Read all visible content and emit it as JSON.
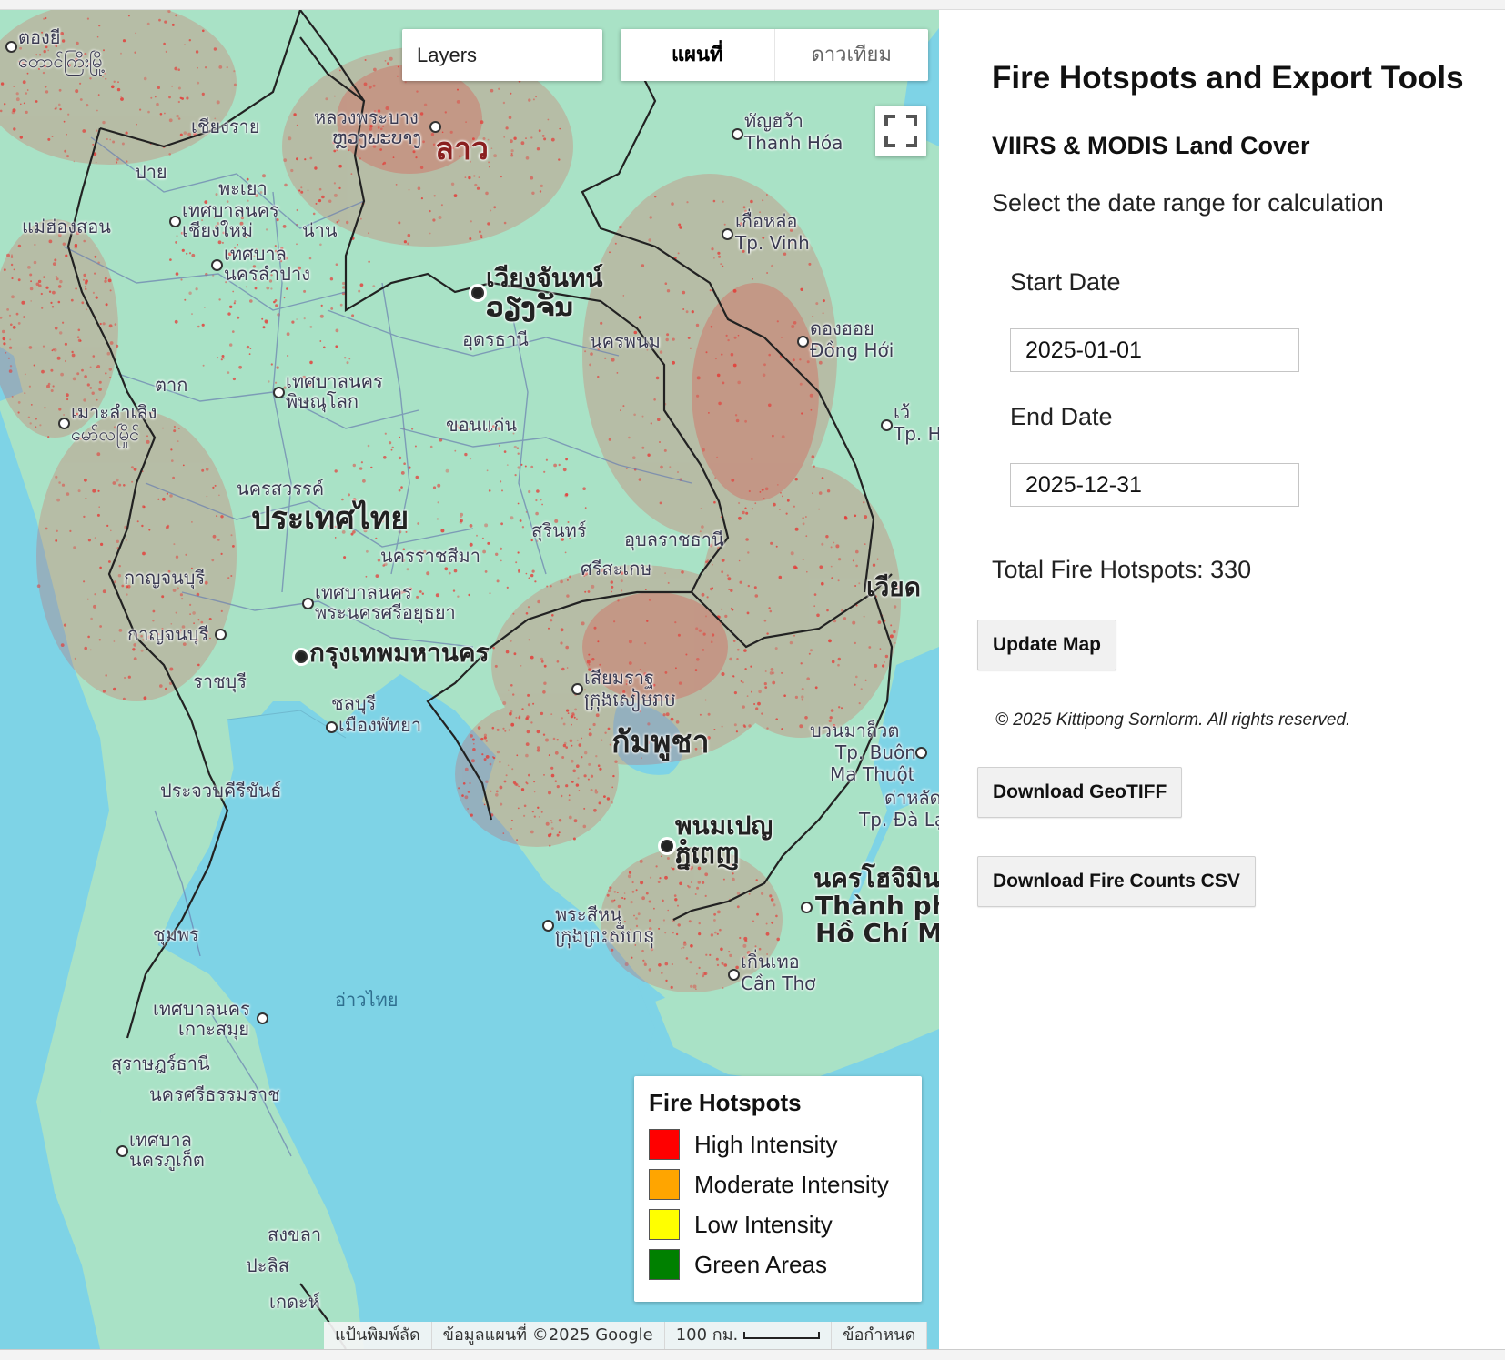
{
  "map": {
    "layers_label": "Layers",
    "maptype_map": "แผนที่",
    "maptype_satellite": "ดาวเทียม",
    "fullscreen_icon": "fullscreen-icon",
    "sea_label": "อ่าวไทย",
    "labels": {
      "c01": "ตองยี",
      "c02": "တောင်ကြီးမြို့",
      "c03": "เชียงราย",
      "c04": "หลวงพระบาง",
      "c05": "ຫຼວງພະບາງ",
      "c06": "ลาว",
      "c07": "ทัญฮว้า",
      "c08": "Thanh Hóa",
      "c09": "ปาย",
      "c10": "พะเยา",
      "c11": "เทศบาลนคร",
      "c12": "เชียงใหม่",
      "c13": "แม่ฮ่องสอน",
      "c14": "น่าน",
      "c15": "เทศบาล",
      "c16": "นครลำปาง",
      "c17": "เกื่อหล่อ",
      "c18": "Tp. Vinh",
      "c19": "เวียงจันทน์",
      "c20": "ວຽງຈັນ",
      "c21": "อุดรธานี",
      "c22": "นครพนม",
      "c23": "ดองฮอย",
      "c24": "Đồng Hới",
      "c25": "ตาก",
      "c26": "เทศบาลนคร",
      "c27": "พิษณุโลก",
      "c28": "เมาะลำเลิง",
      "c29": "မော်လမြိုင်",
      "c30": "ขอนแก่น",
      "c31": "เว้",
      "c32": "Tp. H",
      "c33": "นครสวรรค์",
      "c34": "ประเทศไทย",
      "c35": "สุรินทร์",
      "c36": "อุบลราชธานี",
      "c37": "นครราชสีมา",
      "c38": "ศรีสะเกษ",
      "c39": "เวียด",
      "c40": "กาญจนบุรี",
      "c41": "เทศบาลนคร",
      "c42": "พระนครศรีอยุธยา",
      "c43": "กาญจนบุรี",
      "c44": "กรุงเทพมหานคร",
      "c45": "ราชบุรี",
      "c46": "เสียมราฐ",
      "c47": "ក្រុងសៀមរាប",
      "c48": "ชลบุรี",
      "c49": "เมืองพัทยา",
      "c50": "กัมพูชา",
      "c51": "บวนมาถ็วต",
      "c52": "Tp. Buôn",
      "c53": "Ma Thuột",
      "c54": "ประจวบคีรีขันธ์",
      "c55": "ด่าหลัด",
      "c56": "Tp. Đà Lạt",
      "c57": "พนมเปญ",
      "c58": "ភ្នំពេញ",
      "c59": "นครโฮจิมินห์",
      "c60": "Thành phố",
      "c61": "Hồ Chí Minh",
      "c62": "พระสีหนุ",
      "c63": "ក្រុងព្រះសីហនុ",
      "c64": "ชุมพร",
      "c65": "เกิ่นเทอ",
      "c66": "Cần Thơ",
      "c67": "เทศบาลนคร",
      "c68": "เกาะสมุย",
      "c69": "สุราษฎร์ธานี",
      "c70": "นครศรีธรรมราช",
      "c71": "เทศบาล",
      "c72": "นครภูเก็ต",
      "c73": "สงขลา",
      "c74": "ปะลิส",
      "c75": "เกดะห์"
    },
    "attribution": {
      "shortcuts": "แป้นพิมพ์ลัด",
      "data": "ข้อมูลแผนที่ ©2025 Google",
      "scale": "100 กม.",
      "terms": "ข้อกำหนด"
    },
    "legend": {
      "title": "Fire Hotspots",
      "items": [
        {
          "label": "High Intensity",
          "color": "#ff0000"
        },
        {
          "label": "Moderate Intensity",
          "color": "#ffa500"
        },
        {
          "label": "Low Intensity",
          "color": "#ffff00"
        },
        {
          "label": "Green Areas",
          "color": "#008000"
        }
      ]
    },
    "colors": {
      "water": "#7ed3e6",
      "land": "#a8e3c7",
      "hotspot": "#e53935",
      "border": "#222222"
    }
  },
  "panel": {
    "title": "Fire Hotspots and Export Tools",
    "subtitle": "VIIRS & MODIS Land Cover",
    "instruction": "Select the date range for calculation",
    "start_label": "Start Date",
    "start_value": "2025-01-01",
    "end_label": "End Date",
    "end_value": "2025-12-31",
    "total": "Total Fire Hotspots: 330",
    "update_button": "Update Map",
    "copyright": "© 2025 Kittipong Sornlorm. All rights reserved.",
    "geotiff_button": "Download GeoTIFF",
    "csv_button": "Download Fire Counts CSV"
  }
}
